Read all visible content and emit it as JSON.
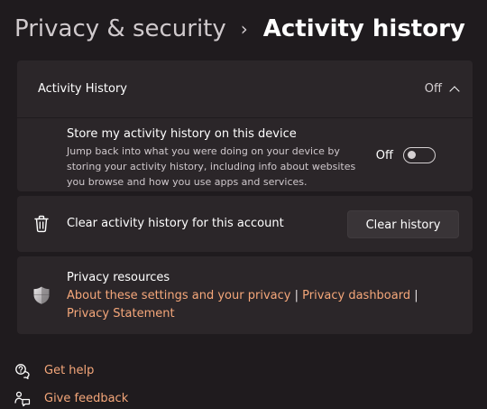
{
  "breadcrumb": {
    "parent": "Privacy & security",
    "separator": "›",
    "current": "Activity history"
  },
  "activity_history": {
    "title": "Activity History",
    "status": "Off",
    "expanded": true,
    "store_setting": {
      "title": "Store my activity history on this device",
      "description": "Jump back into what you were doing on your device by storing your activity history, including info about websites you browse and how you use apps and services.",
      "state_label": "Off",
      "enabled": false
    }
  },
  "clear": {
    "label": "Clear activity history for this account",
    "button_label": "Clear history",
    "icon": "trash-icon"
  },
  "resources": {
    "title": "Privacy resources",
    "icon": "shield-icon",
    "link1": "About these settings and your privacy",
    "link2": "Privacy dashboard",
    "link3": "Privacy Statement",
    "separator": "|"
  },
  "footer": {
    "help_label": "Get help",
    "help_icon": "help-chat-icon",
    "feedback_label": "Give feedback",
    "feedback_icon": "feedback-icon"
  },
  "colors": {
    "background": "#1f1b1e",
    "card": "#2b2629",
    "link": "#f5a77a"
  }
}
